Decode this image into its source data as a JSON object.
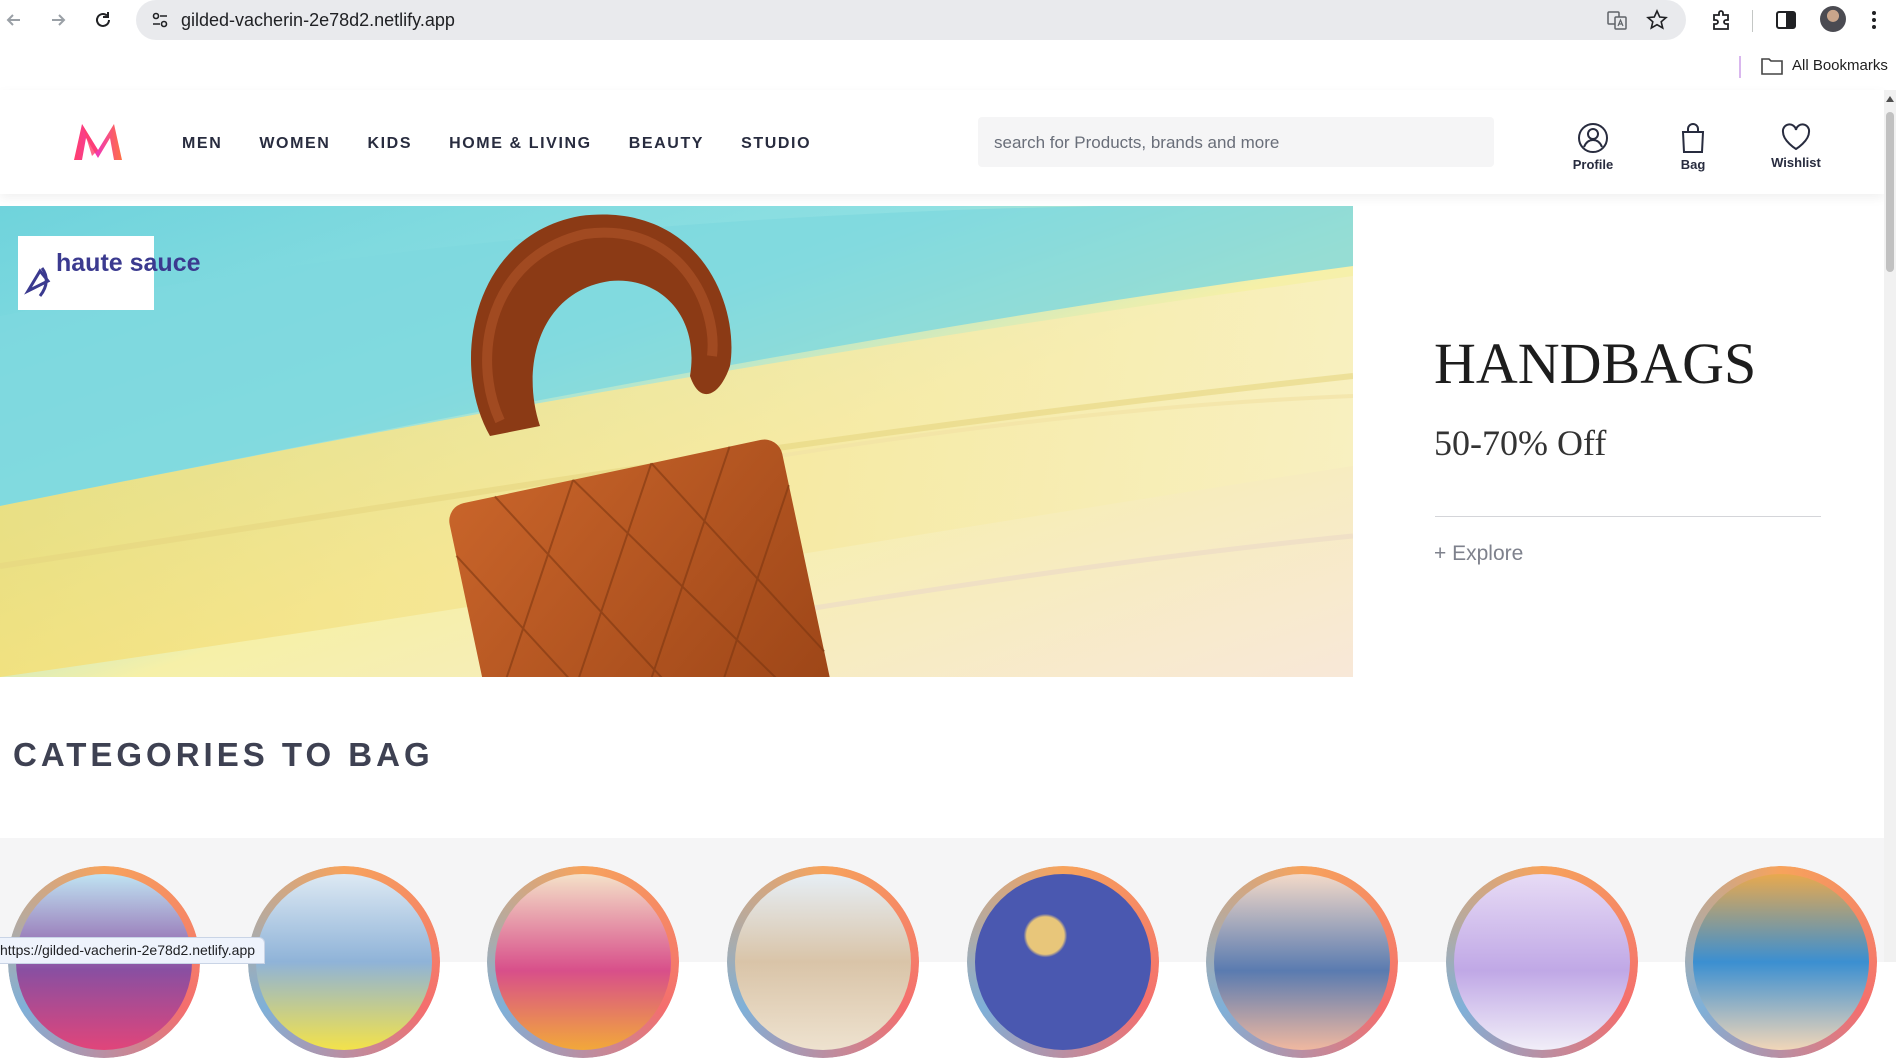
{
  "browser": {
    "url": "gilded-vacherin-2e78d2.netlify.app",
    "bookmarks_label": "All Bookmarks",
    "status_url": "https://gilded-vacherin-2e78d2.netlify.app"
  },
  "header": {
    "menu": [
      "MEN",
      "WOMEN",
      "KIDS",
      "HOME & LIVING",
      "BEAUTY",
      "STUDIO"
    ],
    "search_placeholder": "search for Products, brands and more",
    "actions": {
      "profile": "Profile",
      "bag": "Bag",
      "wishlist": "Wishlist"
    }
  },
  "hero": {
    "brand": "haute sauce",
    "title": "HANDBAGS",
    "subtitle": "50-70% Off",
    "cta": "+ Explore"
  },
  "categories": {
    "heading": "CATEGORIES TO BAG"
  },
  "colors": {
    "brand_pink": "#ff3f6c",
    "brand_orange": "#f7a35c",
    "text_dark": "#282c3f"
  }
}
